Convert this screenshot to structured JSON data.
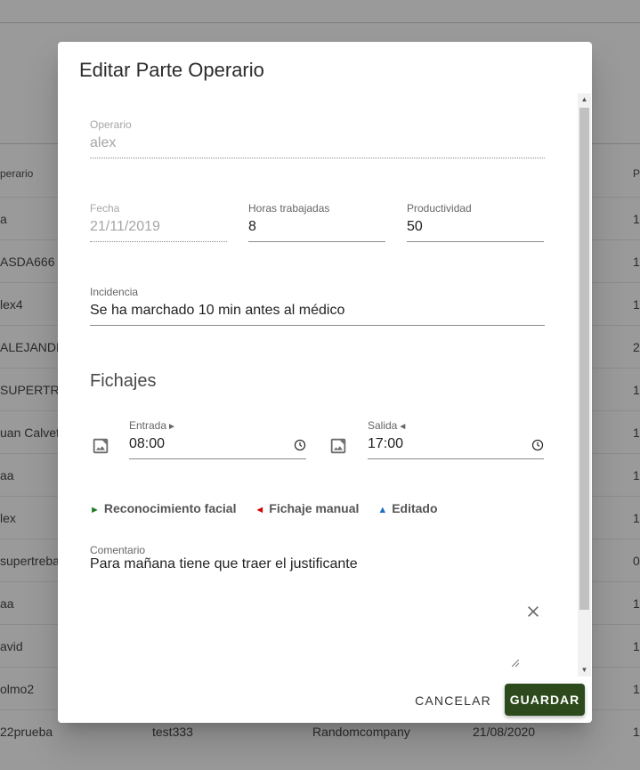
{
  "background_table": {
    "header_col1": "perario",
    "header_col5": "P",
    "rows": [
      {
        "c1": "a",
        "c2": "",
        "c3": "",
        "c4": "",
        "c5": "1"
      },
      {
        "c1": "ASDA666",
        "c2": "",
        "c3": "",
        "c4": "",
        "c5": "1"
      },
      {
        "c1": "lex4",
        "c2": "",
        "c3": "",
        "c4": "",
        "c5": "1"
      },
      {
        "c1": "ALEJANDR",
        "c2": "",
        "c3": "",
        "c4": "",
        "c5": "2"
      },
      {
        "c1": "SUPERTRE",
        "c2": "",
        "c3": "",
        "c4": "",
        "c5": "1"
      },
      {
        "c1": "uan Calvet",
        "c2": "",
        "c3": "",
        "c4": "",
        "c5": "1"
      },
      {
        "c1": "aa",
        "c2": "",
        "c3": "",
        "c4": "",
        "c5": "1"
      },
      {
        "c1": "lex",
        "c2": "",
        "c3": "",
        "c4": "",
        "c5": "1"
      },
      {
        "c1": "supertreba",
        "c2": "",
        "c3": "",
        "c4": "",
        "c5": "0"
      },
      {
        "c1": "aa",
        "c2": "",
        "c3": "",
        "c4": "",
        "c5": "1"
      },
      {
        "c1": "avid",
        "c2": "",
        "c3": "",
        "c4": "",
        "c5": "1"
      },
      {
        "c1": "olmo2",
        "c2": "",
        "c3": "",
        "c4": "",
        "c5": "1"
      },
      {
        "c1": "22prueba",
        "c2": "test333",
        "c3": "Randomcompany",
        "c4": "21/08/2020",
        "c5": "1"
      }
    ]
  },
  "dialog": {
    "title": "Editar Parte Operario",
    "operario": {
      "label": "Operario",
      "value": "alex"
    },
    "fecha": {
      "label": "Fecha",
      "value": "21/11/2019"
    },
    "horas": {
      "label": "Horas trabajadas",
      "value": "8"
    },
    "productividad": {
      "label": "Productividad",
      "value": "50"
    },
    "incidencia": {
      "label": "Incidencia",
      "value": "Se ha marchado 10 min antes al médico"
    },
    "fichajes_title": "Fichajes",
    "entrada": {
      "label": "Entrada",
      "marker": "►",
      "value": "08:00",
      "icon": "image-icon"
    },
    "salida": {
      "label": "Salida",
      "marker": "◄",
      "value": "17:00",
      "icon": "image-icon"
    },
    "legend": [
      {
        "mark": "►",
        "color": "#1e7d1e",
        "label": "Reconocimiento facial"
      },
      {
        "mark": "◄",
        "color": "#d40000",
        "label": "Fichaje manual"
      },
      {
        "mark": "▲",
        "color": "#1f6fc0",
        "label": "Editado"
      }
    ],
    "comentario": {
      "label": "Comentario",
      "value": "Para mañana tiene que traer el justificante"
    },
    "buttons": {
      "cancel": "CANCELAR",
      "save": "GUARDAR"
    },
    "colors": {
      "save_bg": "#2c4a1c"
    }
  }
}
